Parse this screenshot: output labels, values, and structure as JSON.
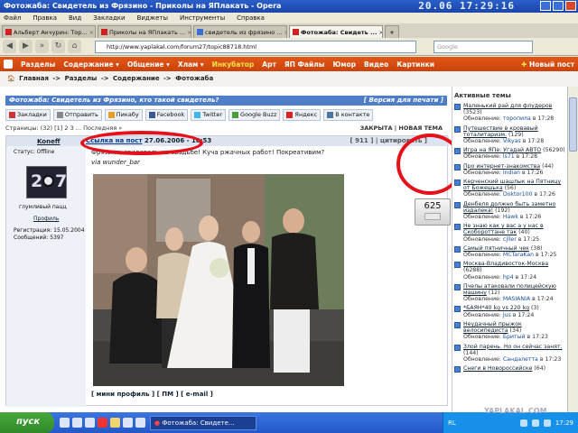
{
  "window": {
    "title": "Фотожаба: Свидетель из Фрязино - Приколы на ЯПлакать - Opera",
    "clock": "20.06 17:29:16"
  },
  "menu": [
    "Файл",
    "Правка",
    "Вид",
    "Закладки",
    "Виджеты",
    "Инструменты",
    "Справка"
  ],
  "tabs": [
    {
      "label": "Альберт Акчурин: Тор...",
      "active": false
    },
    {
      "label": "Приколы на ЯПлакать ...",
      "active": false
    },
    {
      "label": "свидетель из фрязино ...",
      "active": false
    },
    {
      "label": "Фотожаба: Свидеть ...",
      "active": true
    }
  ],
  "address": {
    "url": "http://www.yaplakal.com/forum27/topic88718.html",
    "search_placeholder": "Google"
  },
  "site_nav": {
    "items": [
      "Разделы",
      "Содержание ▾",
      "Общение ▾",
      "Хлам ▾",
      "Инкубатор",
      "Арт",
      "ЯП Файлы",
      "Юмор",
      "Видео",
      "Картинки"
    ],
    "new_post": "Новый пост"
  },
  "breadcrumb": {
    "items": [
      "Главная",
      "Разделы",
      "Содержание",
      "Фотожаба"
    ],
    "sep": "->"
  },
  "topic": {
    "title": "Фотожаба: Свидетель из Фрязино, кто такой свидетель?",
    "print": "[ Версия для печати ]"
  },
  "share": [
    "Закладки",
    "Отправить",
    "Пикабу",
    "Facebook",
    "Twitter",
    "Google Buzz",
    "Яндекс",
    "В контакте"
  ],
  "pager": {
    "text": "Страницы: (32) [1] 2 3 ... Последняя »",
    "closed": "ЗАКРЫТА | НОВАЯ ТЕМА"
  },
  "post": {
    "author": "Koneff",
    "permalink": "Ссылка на пост",
    "date": "27.06.2006 - 10:53",
    "number": "[ 911 ] | цитировать ]",
    "status": "Статус: Offline",
    "rank": "глумливый пацц",
    "profile": "Профиль",
    "registered": "Регистрация: 15.05.2004",
    "messages": "Сообщений: 5397",
    "text": "Фрязино, свидетель на свадьбе! Куча ржачных работ! Покреативим?",
    "via": "via wunder_bar",
    "rating": "625",
    "footer": "[ мини профиль ] [ ПМ ] [ e-mail ]"
  },
  "sidebar": {
    "title": "Активные темы",
    "items": [
      {
        "title": "Маленький рай для флудеров",
        "count": "(3523)",
        "prefix": "Обновление:",
        "user": "торопила",
        "time": "в 17:28"
      },
      {
        "title": "Путешествие в кровавый тоталитаризм.",
        "count": "(129)",
        "prefix": "Обновление:",
        "user": "Vikyas",
        "time": "в 17:28"
      },
      {
        "title": "Игра на ЯПе: Угадай АВТО",
        "count": "(56290)",
        "prefix": "Обновление:",
        "user": "ls71",
        "time": "в 17:28"
      },
      {
        "title": "Про интернет-знакомства",
        "count": "(44)",
        "prefix": "Обновление:",
        "user": "Indian",
        "time": "в 17:26"
      },
      {
        "title": "Керченский шашлык на Пятницу от Божешька",
        "count": "(56)",
        "prefix": "Обновление:",
        "user": "Doktor100",
        "time": "в 17:26"
      },
      {
        "title": "Денбеля должно быть заметно издалека!",
        "count": "(192)",
        "prefix": "Обновление:",
        "user": "Hawk",
        "time": "в 17:26"
      },
      {
        "title": "Не знаю как у вас а у нас в Скобороттане так",
        "count": "(40)",
        "prefix": "Обновление:",
        "user": "cjller",
        "time": "в 17:25"
      },
      {
        "title": "Самый пятничный чек",
        "count": "(38)",
        "prefix": "Обновление:",
        "user": "MCTaraKan",
        "time": "в 17:25"
      },
      {
        "title": "Москва-Владивосток-Москва",
        "count": "(6288)",
        "prefix": "Обновление:",
        "user": "hp4",
        "time": "в 17:24"
      },
      {
        "title": "Пчелы атаковали полицейскую машину",
        "count": "(12)",
        "prefix": "Обновление:",
        "user": "MASIANIA",
        "time": "в 17:24"
      },
      {
        "title": "*БАЯН*40 kg vs 220 kg",
        "count": "(3)",
        "prefix": "Обновление:",
        "user": "Jus",
        "time": "в 17:24"
      },
      {
        "title": "Неудачный прыжок велосипедиста",
        "count": "(34)",
        "prefix": "Обновление:",
        "user": "Бритый",
        "time": "в 17:23"
      },
      {
        "title": "Злой парень. Но он сейчас занят.",
        "count": "(144)",
        "prefix": "Обновление:",
        "user": "Сандалетта",
        "time": "в 17:23"
      },
      {
        "title": "Снеги в Новороссийске",
        "count": "(64)",
        "prefix": "",
        "user": "",
        "time": ""
      }
    ]
  },
  "taskbar": {
    "start": "пуск",
    "task": "Фотожаба: Свидете...",
    "lang": "RL",
    "time": "17:29",
    "watermark": "YAPLAKAL.COM"
  },
  "colors": {
    "accent": "#e25716",
    "link": "#1b4fa0",
    "highlight": "#e5101a",
    "header": "#4f7ec9"
  }
}
